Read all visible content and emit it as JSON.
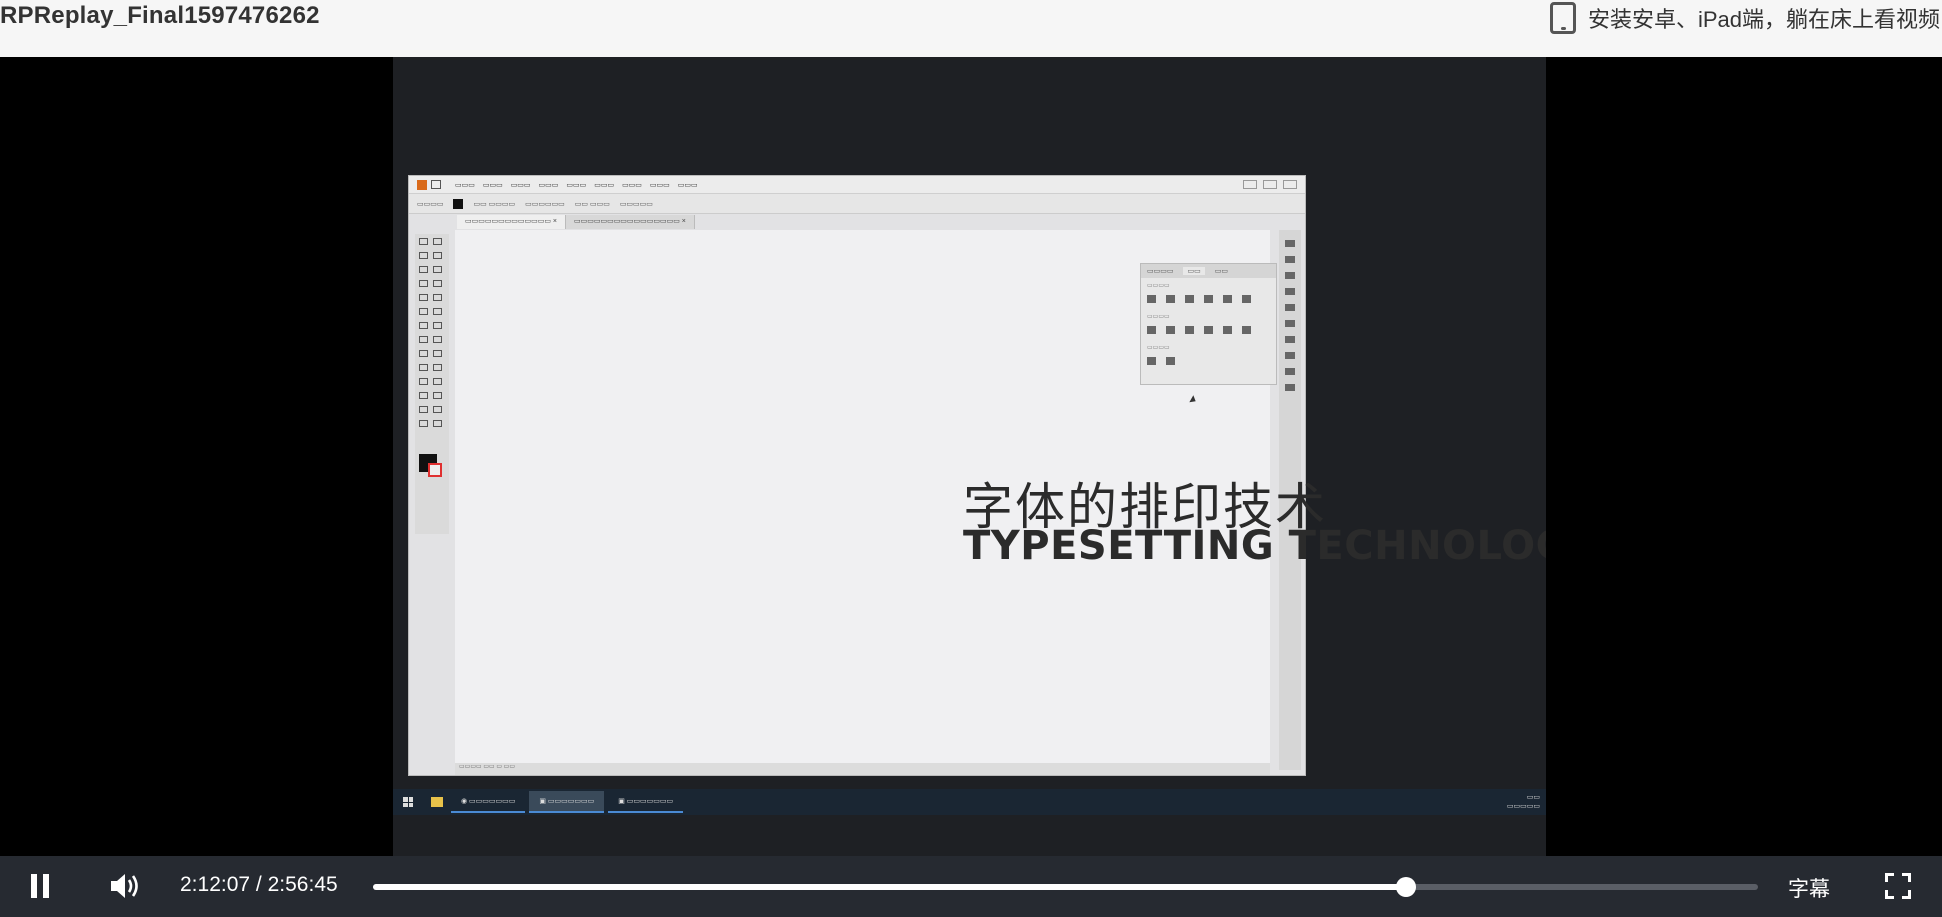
{
  "header": {
    "title": "RPReplay_Final1597476262",
    "promo_text": "安装安卓、iPad端，躺在床上看视频",
    "promo_icon": "tablet-icon"
  },
  "video": {
    "illustrator": {
      "cn_title": "字体的排印技术",
      "en_title": "TYPESETTING TECHNOLOGY OF FONT"
    }
  },
  "controls": {
    "current_time": "2:12:07",
    "separator": "/",
    "duration": "2:56:45",
    "progress": 0.746,
    "subtitle_label": "字幕",
    "play_icon": "pause-icon",
    "volume_icon": "volume-icon",
    "fullscreen_icon": "fullscreen-icon",
    "colors": {
      "bar": "#262a31",
      "track": "#5a5e66",
      "fill": "#ffffff"
    }
  }
}
